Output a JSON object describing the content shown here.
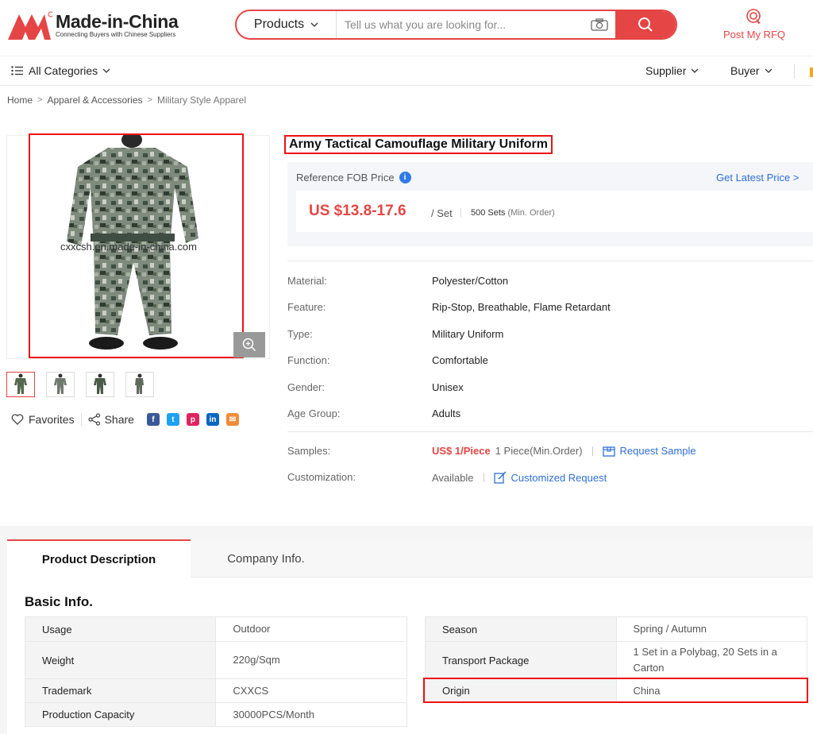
{
  "header": {
    "logo_title": "Made-in-China",
    "logo_subtitle": "Connecting Buyers with Chinese Suppliers",
    "search_category": "Products",
    "search_placeholder": "Tell us what you are looking for...",
    "rfq_label": "Post My RFQ"
  },
  "nav": {
    "all_categories": "All Categories",
    "supplier": "Supplier",
    "buyer": "Buyer"
  },
  "breadcrumb": [
    "Home",
    "Apparel & Accessories",
    "Military Style Apparel"
  ],
  "gallery": {
    "watermark": "cxxcsh.en.made-in-china.com",
    "favorites": "Favorites",
    "share": "Share"
  },
  "product": {
    "title": "Army Tactical Camouflage Military Uniform",
    "price_label": "Reference FOB Price",
    "latest_price": "Get Latest Price",
    "price": "US $13.8-17.6",
    "unit": "/ Set",
    "moq": "500 Sets",
    "moq_note": "(Min. Order)",
    "attributes": [
      {
        "key": "Material:",
        "value": "Polyester/Cotton"
      },
      {
        "key": "Feature:",
        "value": "Rip-Stop, Breathable, Flame Retardant"
      },
      {
        "key": "Type:",
        "value": "Military Uniform"
      },
      {
        "key": "Function:",
        "value": "Comfortable"
      },
      {
        "key": "Gender:",
        "value": "Unisex"
      },
      {
        "key": "Age Group:",
        "value": "Adults"
      }
    ],
    "samples_label": "Samples:",
    "samples_price": "US$ 1/Piece",
    "samples_moq": "1 Piece(Min.Order)",
    "request_sample": "Request Sample",
    "customization_label": "Customization:",
    "customization_value": "Available",
    "customized_request": "Customized Request"
  },
  "tabs": {
    "active": "Product Description",
    "other": "Company Info."
  },
  "basic_info": {
    "title": "Basic Info.",
    "left": [
      {
        "key": "Usage",
        "value": "Outdoor"
      },
      {
        "key": "Weight",
        "value": "220g/Sqm"
      },
      {
        "key": "Trademark",
        "value": "CXXCS"
      },
      {
        "key": "Production Capacity",
        "value": "30000PCS/Month"
      }
    ],
    "right": [
      {
        "key": "Season",
        "value": "Spring / Autumn"
      },
      {
        "key": "Transport Package",
        "value": "1 Set in a Polybag, 20 Sets in a Carton"
      },
      {
        "key": "Origin",
        "value": "China"
      }
    ]
  },
  "colors": {
    "brand_red": "#e64545",
    "link_blue": "#2f6fd6",
    "highlight_red": "#e11111"
  }
}
